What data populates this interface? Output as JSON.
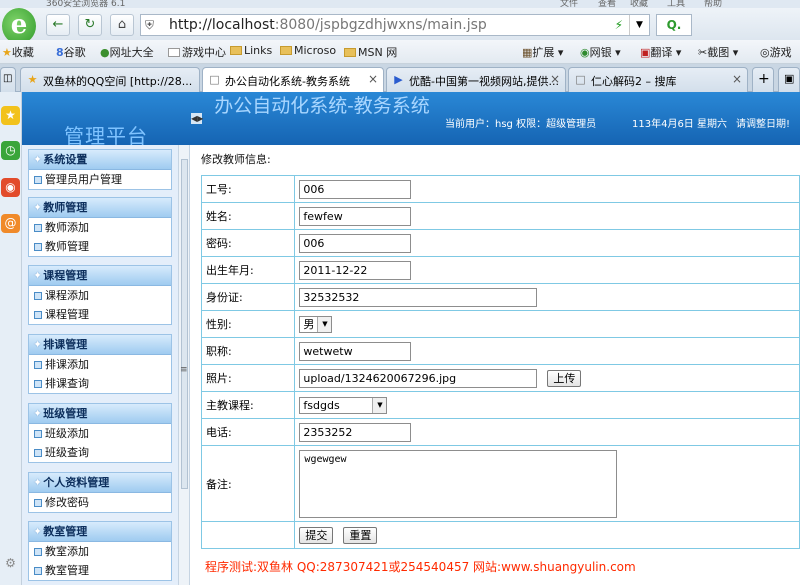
{
  "browser": {
    "title_fragment": "360安全浏览器 6.1",
    "menu_fragments": [
      "文件",
      "查看",
      "收藏",
      "工具",
      "帮助"
    ],
    "logo_glyph": "e",
    "url": {
      "host": "http://localhost",
      "path": ":8080/jspbgzdhjwxns/main.jsp"
    },
    "search_label": "Q.",
    "bookmarks": [
      "收藏",
      "谷歌",
      "网址大全",
      "游戏中心",
      "Links",
      "Microso",
      "MSN 网",
      "扩展",
      "网银",
      "翻译",
      "截图",
      "游戏"
    ],
    "tabs": [
      {
        "label": "双鱼林的QQ空间 [http://28...",
        "icon": "star-icon"
      },
      {
        "label": "办公自动化系统-教务系统",
        "icon": "page-icon",
        "active": true
      },
      {
        "label": "优酷-中国第一视频网站,提供...",
        "icon": "video-icon"
      },
      {
        "label": "仁心解码2 – 搜库",
        "icon": "page-icon"
      }
    ],
    "colors": {
      "accent": "#2f9a2a",
      "chrome": "#dde6ef"
    }
  },
  "header": {
    "platform_title": "管理平台",
    "system_title": "办公自动化系统-教务系统",
    "user_info": "当前用户：hsg 权限：超级管理员",
    "date": "113年4月6日 星期六",
    "greeting": "请调整日期!"
  },
  "sidebar": {
    "groups": [
      {
        "title": "系统设置",
        "items": [
          "管理员用户管理"
        ]
      },
      {
        "title": "教师管理",
        "items": [
          "教师添加",
          "教师管理"
        ]
      },
      {
        "title": "课程管理",
        "items": [
          "课程添加",
          "课程管理"
        ]
      },
      {
        "title": "排课管理",
        "items": [
          "排课添加",
          "排课查询"
        ]
      },
      {
        "title": "班级管理",
        "items": [
          "班级添加",
          "班级查询"
        ]
      },
      {
        "title": "个人资料管理",
        "items": [
          "修改密码"
        ]
      },
      {
        "title": "教室管理",
        "items": [
          "教室添加",
          "教室管理"
        ]
      }
    ]
  },
  "form": {
    "caption": "修改教师信息:",
    "fields": {
      "id": {
        "label": "工号:",
        "value": "006"
      },
      "name": {
        "label": "姓名:",
        "value": "fewfew"
      },
      "password": {
        "label": "密码:",
        "value": "006"
      },
      "birth": {
        "label": "出生年月:",
        "value": "2011-12-22"
      },
      "idcard": {
        "label": "身份证:",
        "value": "32532532"
      },
      "gender": {
        "label": "性别:",
        "value": "男"
      },
      "title": {
        "label": "职称:",
        "value": "wetwetw"
      },
      "photo": {
        "label": "照片:",
        "value": "upload/1324620067296.jpg",
        "button": "上传"
      },
      "course": {
        "label": "主教课程:",
        "value": "fsdgds"
      },
      "phone": {
        "label": "电话:",
        "value": "2353252"
      },
      "remark": {
        "label": "备注:",
        "value": "wgewgew"
      }
    },
    "submit": "提交",
    "reset": "重置",
    "footer": "程序测试:双鱼林 QQ:287307421或254540457 网站:www.shuangyulin.com"
  }
}
